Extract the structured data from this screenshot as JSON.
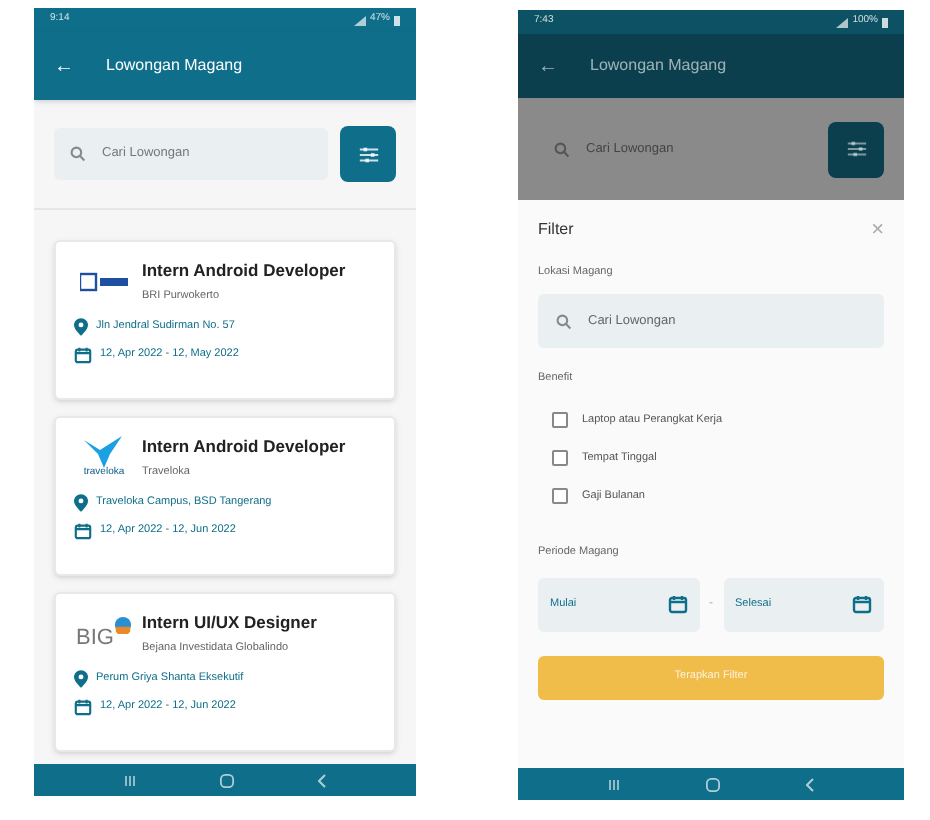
{
  "list_screen": {
    "status_bar": {
      "time": "9:14",
      "battery": "47%"
    },
    "app_bar": {
      "back": "←",
      "title": "Lowongan Magang"
    },
    "search": {
      "placeholder": "Cari Lowongan"
    },
    "jobs": [
      {
        "kind": "bank",
        "title": "Intern Android Developer",
        "company": "BRI Purwokerto",
        "location": "Jln Jendral Sudirman No. 57",
        "period": "12, Apr 2022 - 12, May 2022"
      },
      {
        "kind": "bird",
        "logo_text": "traveloka",
        "title": "Intern Android Developer",
        "company": "Traveloka",
        "location": "Traveloka Campus, BSD Tangerang",
        "period": "12, Apr 2022 - 12, Jun 2022"
      },
      {
        "kind": "big",
        "logo_text": "BIG",
        "title": "Intern UI/UX Designer",
        "company": "Bejana Investidata Globalindo",
        "location": "Perum Griya Shanta Eksekutif",
        "period": "12, Apr 2022 - 12, Jun 2022"
      }
    ]
  },
  "filter_screen": {
    "status_bar": {
      "time": "7:43",
      "battery": "100%"
    },
    "app_bar": {
      "back": "←",
      "title": "Lowongan Magang"
    },
    "search": {
      "placeholder": "Cari Lowongan"
    },
    "sheet": {
      "title": "Filter",
      "close": "×",
      "location_label": "Lokasi Magang",
      "location_placeholder": "Cari Lowongan",
      "benefit_label": "Benefit",
      "benefits": [
        {
          "label": "Laptop atau Perangkat Kerja",
          "checked": false
        },
        {
          "label": "Tempat Tinggal",
          "checked": false
        },
        {
          "label": "Gaji Bulanan",
          "checked": false
        }
      ],
      "period_label": "Periode Magang",
      "start_placeholder": "Mulai",
      "separator": "-",
      "end_placeholder": "Selesai",
      "apply": "Terapkan Filter"
    }
  }
}
